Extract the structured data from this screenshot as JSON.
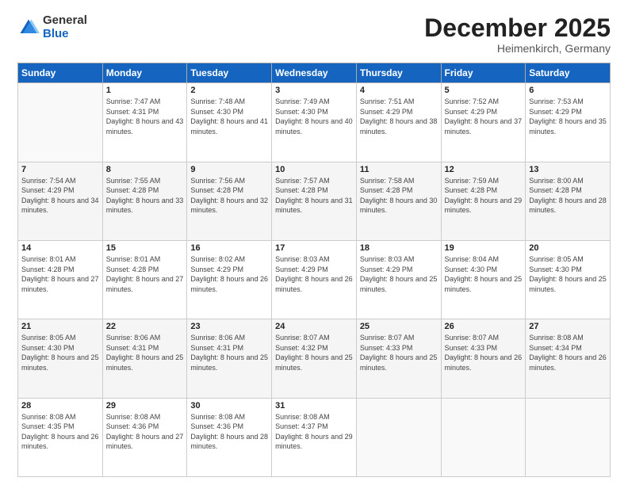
{
  "logo": {
    "general": "General",
    "blue": "Blue"
  },
  "header": {
    "month": "December 2025",
    "location": "Heimenkirch, Germany"
  },
  "weekdays": [
    "Sunday",
    "Monday",
    "Tuesday",
    "Wednesday",
    "Thursday",
    "Friday",
    "Saturday"
  ],
  "weeks": [
    [
      {
        "day": "",
        "sunrise": "",
        "sunset": "",
        "daylight": ""
      },
      {
        "day": "1",
        "sunrise": "Sunrise: 7:47 AM",
        "sunset": "Sunset: 4:31 PM",
        "daylight": "Daylight: 8 hours and 43 minutes."
      },
      {
        "day": "2",
        "sunrise": "Sunrise: 7:48 AM",
        "sunset": "Sunset: 4:30 PM",
        "daylight": "Daylight: 8 hours and 41 minutes."
      },
      {
        "day": "3",
        "sunrise": "Sunrise: 7:49 AM",
        "sunset": "Sunset: 4:30 PM",
        "daylight": "Daylight: 8 hours and 40 minutes."
      },
      {
        "day": "4",
        "sunrise": "Sunrise: 7:51 AM",
        "sunset": "Sunset: 4:29 PM",
        "daylight": "Daylight: 8 hours and 38 minutes."
      },
      {
        "day": "5",
        "sunrise": "Sunrise: 7:52 AM",
        "sunset": "Sunset: 4:29 PM",
        "daylight": "Daylight: 8 hours and 37 minutes."
      },
      {
        "day": "6",
        "sunrise": "Sunrise: 7:53 AM",
        "sunset": "Sunset: 4:29 PM",
        "daylight": "Daylight: 8 hours and 35 minutes."
      }
    ],
    [
      {
        "day": "7",
        "sunrise": "Sunrise: 7:54 AM",
        "sunset": "Sunset: 4:29 PM",
        "daylight": "Daylight: 8 hours and 34 minutes."
      },
      {
        "day": "8",
        "sunrise": "Sunrise: 7:55 AM",
        "sunset": "Sunset: 4:28 PM",
        "daylight": "Daylight: 8 hours and 33 minutes."
      },
      {
        "day": "9",
        "sunrise": "Sunrise: 7:56 AM",
        "sunset": "Sunset: 4:28 PM",
        "daylight": "Daylight: 8 hours and 32 minutes."
      },
      {
        "day": "10",
        "sunrise": "Sunrise: 7:57 AM",
        "sunset": "Sunset: 4:28 PM",
        "daylight": "Daylight: 8 hours and 31 minutes."
      },
      {
        "day": "11",
        "sunrise": "Sunrise: 7:58 AM",
        "sunset": "Sunset: 4:28 PM",
        "daylight": "Daylight: 8 hours and 30 minutes."
      },
      {
        "day": "12",
        "sunrise": "Sunrise: 7:59 AM",
        "sunset": "Sunset: 4:28 PM",
        "daylight": "Daylight: 8 hours and 29 minutes."
      },
      {
        "day": "13",
        "sunrise": "Sunrise: 8:00 AM",
        "sunset": "Sunset: 4:28 PM",
        "daylight": "Daylight: 8 hours and 28 minutes."
      }
    ],
    [
      {
        "day": "14",
        "sunrise": "Sunrise: 8:01 AM",
        "sunset": "Sunset: 4:28 PM",
        "daylight": "Daylight: 8 hours and 27 minutes."
      },
      {
        "day": "15",
        "sunrise": "Sunrise: 8:01 AM",
        "sunset": "Sunset: 4:28 PM",
        "daylight": "Daylight: 8 hours and 27 minutes."
      },
      {
        "day": "16",
        "sunrise": "Sunrise: 8:02 AM",
        "sunset": "Sunset: 4:29 PM",
        "daylight": "Daylight: 8 hours and 26 minutes."
      },
      {
        "day": "17",
        "sunrise": "Sunrise: 8:03 AM",
        "sunset": "Sunset: 4:29 PM",
        "daylight": "Daylight: 8 hours and 26 minutes."
      },
      {
        "day": "18",
        "sunrise": "Sunrise: 8:03 AM",
        "sunset": "Sunset: 4:29 PM",
        "daylight": "Daylight: 8 hours and 25 minutes."
      },
      {
        "day": "19",
        "sunrise": "Sunrise: 8:04 AM",
        "sunset": "Sunset: 4:30 PM",
        "daylight": "Daylight: 8 hours and 25 minutes."
      },
      {
        "day": "20",
        "sunrise": "Sunrise: 8:05 AM",
        "sunset": "Sunset: 4:30 PM",
        "daylight": "Daylight: 8 hours and 25 minutes."
      }
    ],
    [
      {
        "day": "21",
        "sunrise": "Sunrise: 8:05 AM",
        "sunset": "Sunset: 4:30 PM",
        "daylight": "Daylight: 8 hours and 25 minutes."
      },
      {
        "day": "22",
        "sunrise": "Sunrise: 8:06 AM",
        "sunset": "Sunset: 4:31 PM",
        "daylight": "Daylight: 8 hours and 25 minutes."
      },
      {
        "day": "23",
        "sunrise": "Sunrise: 8:06 AM",
        "sunset": "Sunset: 4:31 PM",
        "daylight": "Daylight: 8 hours and 25 minutes."
      },
      {
        "day": "24",
        "sunrise": "Sunrise: 8:07 AM",
        "sunset": "Sunset: 4:32 PM",
        "daylight": "Daylight: 8 hours and 25 minutes."
      },
      {
        "day": "25",
        "sunrise": "Sunrise: 8:07 AM",
        "sunset": "Sunset: 4:33 PM",
        "daylight": "Daylight: 8 hours and 25 minutes."
      },
      {
        "day": "26",
        "sunrise": "Sunrise: 8:07 AM",
        "sunset": "Sunset: 4:33 PM",
        "daylight": "Daylight: 8 hours and 26 minutes."
      },
      {
        "day": "27",
        "sunrise": "Sunrise: 8:08 AM",
        "sunset": "Sunset: 4:34 PM",
        "daylight": "Daylight: 8 hours and 26 minutes."
      }
    ],
    [
      {
        "day": "28",
        "sunrise": "Sunrise: 8:08 AM",
        "sunset": "Sunset: 4:35 PM",
        "daylight": "Daylight: 8 hours and 26 minutes."
      },
      {
        "day": "29",
        "sunrise": "Sunrise: 8:08 AM",
        "sunset": "Sunset: 4:36 PM",
        "daylight": "Daylight: 8 hours and 27 minutes."
      },
      {
        "day": "30",
        "sunrise": "Sunrise: 8:08 AM",
        "sunset": "Sunset: 4:36 PM",
        "daylight": "Daylight: 8 hours and 28 minutes."
      },
      {
        "day": "31",
        "sunrise": "Sunrise: 8:08 AM",
        "sunset": "Sunset: 4:37 PM",
        "daylight": "Daylight: 8 hours and 29 minutes."
      },
      {
        "day": "",
        "sunrise": "",
        "sunset": "",
        "daylight": ""
      },
      {
        "day": "",
        "sunrise": "",
        "sunset": "",
        "daylight": ""
      },
      {
        "day": "",
        "sunrise": "",
        "sunset": "",
        "daylight": ""
      }
    ]
  ]
}
